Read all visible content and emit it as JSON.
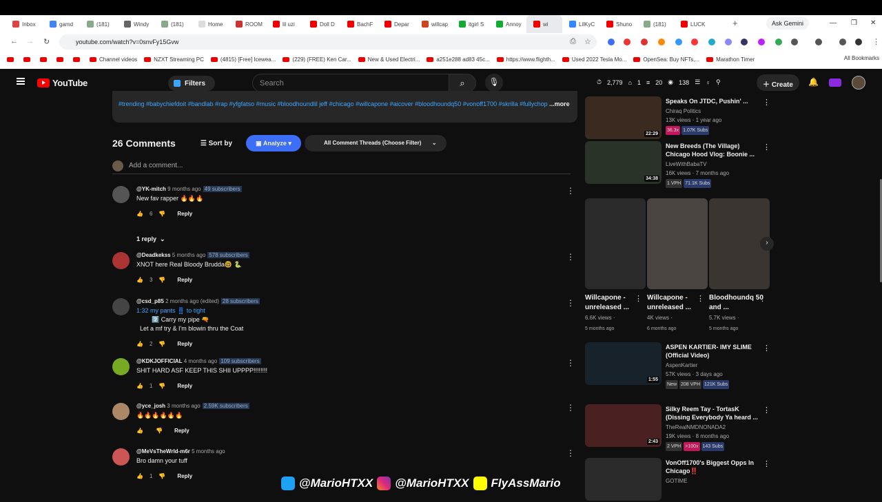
{
  "browser": {
    "tabs": [
      "Inbox",
      "gamd",
      "(181)",
      "Windy",
      "(181)",
      "Home",
      "ROOM",
      "lil uzi",
      "Doll D",
      "BachF",
      "Depar",
      "willcap",
      "itgirl S",
      "Annoy",
      "wi",
      "LilKyC",
      "Shuno",
      "(181)",
      "LUCK"
    ],
    "ask_gemini": "Ask Gemini",
    "url": "youtube.com/watch?v=0snvFy15Gvw",
    "bookmarks": [
      "Channel videos",
      "NZXT Streaming PC",
      "(4815) [Free] Icewea...",
      "(229) (FREE) Ken Car...",
      "New & Used Electri...",
      "a251e288 ad83 45c...",
      "https://www.flighth...",
      "Used 2022 Tesla Mo...",
      "OpenSea: Buy NFTs,...",
      "Marathon Timer"
    ],
    "all_bookmarks": "All Bookmarks"
  },
  "header": {
    "logo": "YouTube",
    "filters": "Filters",
    "search_placeholder": "Search",
    "stats": [
      "2,779",
      "1",
      "20",
      "138"
    ],
    "create": "Create"
  },
  "description": {
    "hashtags": "#trending #babychiefdoit #bandlab #rap #yfgfatso #music #bloodhoundlil jeff #chicago #willcapone #aicover #bloodhoundq50 #vonoff1700 #skrilla #fullychop",
    "more": "...more"
  },
  "comments_header": {
    "count": "26 Comments",
    "sort": "Sort by",
    "analyze": "Analyze",
    "threads": "All Comment Threads (Choose Filter)",
    "add": "Add a comment..."
  },
  "comments": [
    {
      "user": "@YK-mitch",
      "time": "9 months ago",
      "subs": "49 subscribers",
      "text": [
        "New fav rapper 🔥🔥🔥"
      ],
      "likes": "6"
    },
    {
      "user": "@Deadkekss",
      "time": "5 months ago",
      "subs": "578 subscribers",
      "text": [
        "XNOT here Real Bloody Brudda🤓 🐍"
      ],
      "likes": "3"
    },
    {
      "user": "@csd_p85",
      "time": "2 months ago (edited)",
      "subs": "28 subscribers",
      "text": [
        "1:32 my pants 👖 to tight",
        "2️⃣ Carry my pipe 🔫",
        "Let a mf try & I'm blowin thru the Coat"
      ],
      "likes": "2"
    },
    {
      "user": "@KDKJOFFICIAL",
      "time": "4 months ago",
      "subs": "109 subscribers",
      "text": [
        "SHIT HARD ASF KEEP THIS SHII UPPPP!!!!!!!!"
      ],
      "likes": "1"
    },
    {
      "user": "@yce_josh",
      "time": "3 months ago",
      "subs": "2.59K subscribers",
      "text": [
        "🔥🔥🔥🔥🔥🔥"
      ],
      "likes": ""
    },
    {
      "user": "@MeVsTheWrld-m6r",
      "time": "5 months ago",
      "subs": "",
      "text": [
        "Bro damn your tuff"
      ],
      "likes": "1"
    }
  ],
  "reply_label": "Reply",
  "replies_toggle": "1 reply",
  "sidebar": [
    {
      "title": "Speaks On JTDC, Pushin' ...",
      "channel": "Chiraq Politics",
      "meta": "13K views · 1 year ago",
      "tags": [
        "36.3x",
        "1.07K Subs"
      ],
      "duration": "22:29"
    },
    {
      "title": "New Breeds (The Village) Chicago Hood Vlog: Boonie ...",
      "channel": "LiveWithBabaTV",
      "meta": "16K views · 7 months ago",
      "tags": [
        "1 VPH",
        "71.1K Subs"
      ],
      "duration": "34:38"
    },
    {
      "title": "ASPEN KARTIER- IMY SLIME (Official Video)",
      "channel": "AspenKartier",
      "meta": "57K views · 3 days ago",
      "tags": [
        "New",
        "208 VPH",
        "121K Subs"
      ],
      "duration": "1:55"
    },
    {
      "title": "Silky Reem Tay - TortasK (Dissing Everybody Ya heard ...",
      "channel": "TheRealNMDNONADA2",
      "meta": "19K views · 8 months ago",
      "tags": [
        "2 VPH",
        ">100x",
        "143 Subs"
      ],
      "duration": "2:43"
    },
    {
      "title": "VonOff1700's Biggest Opps In Chicago‼️",
      "channel": "GOTIME",
      "meta": "",
      "tags": [],
      "duration": ""
    }
  ],
  "shorts": [
    {
      "title": "Willcapone - unreleased ...",
      "views": "6.6K views ·",
      "age": "5 months ago"
    },
    {
      "title": "Willcapone - unreleased ...",
      "views": "4K views ·",
      "age": "6 months ago"
    },
    {
      "title": "Bloodhoundq 50 and ...",
      "views": "5.7K views ·",
      "age": "5 months ago"
    }
  ],
  "watermark": [
    "@MarioHTXX",
    "@MarioHTXX",
    "FlyAssMario"
  ],
  "colors": {
    "accent": "#3ea6ff",
    "analyze": "#3d6ef7",
    "yt_red": "#ff0000"
  }
}
